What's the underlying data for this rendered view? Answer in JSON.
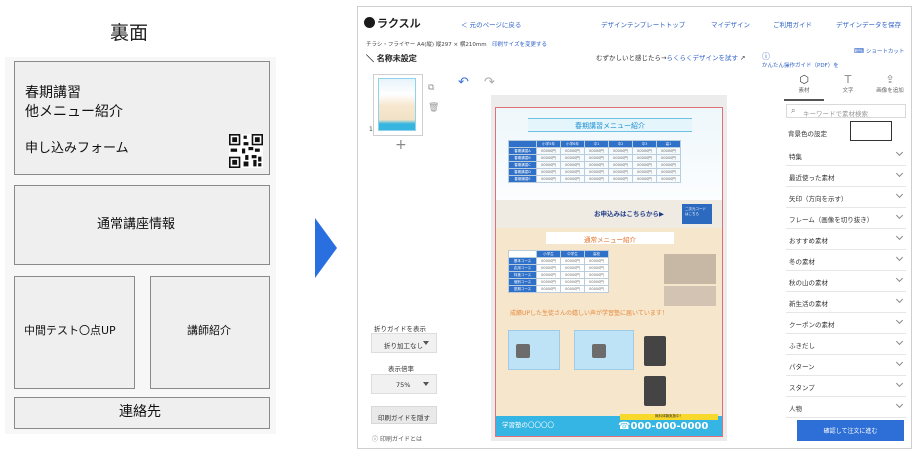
{
  "wireframe": {
    "title": "裏面",
    "box1": {
      "line1": "春期講習",
      "line2": "他メニュー紹介",
      "line3": "申し込みフォーム"
    },
    "box2": "通常講座情報",
    "box3": "中間テスト〇点UP",
    "box4": "講師紹介",
    "box5": "連絡先"
  },
  "app": {
    "logo": "ラクスル",
    "nav": [
      "＜ 元のページに戻る",
      "デザインテンプレートトップ",
      "マイデザイン",
      "ご利用ガイド",
      "デザインデータを保存"
    ],
    "product_line": "チラシ・フライヤー A4(縦)  縦297 × 横210mm",
    "change_size": "印刷サイズを変更する",
    "title": "名称未設定",
    "hint_prefix": "むずかしいと感じたら→",
    "hint_link": "らくらくデザインを試す",
    "help": "かんたん操作ガイド（PDF）を",
    "shortcut": "ショートカット"
  },
  "pages": {
    "num": "1",
    "add": "+"
  },
  "left_controls": {
    "guide_label": "折りガイドを表示",
    "guide_value": "折り加工なし",
    "zoom_label": "表示倍率",
    "zoom_value": "75%",
    "print_guide_btn": "印刷ガイドを隠す",
    "print_help": "印刷ガイドとは"
  },
  "flyer": {
    "h1": "春期講習メニュー紹介",
    "table1_headers": [
      "",
      "小学5年",
      "小学6年",
      "中1",
      "中2",
      "中3",
      "高1"
    ],
    "table1_rows": [
      "春期講習A",
      "春期講習B",
      "春期講習C",
      "春期講習D",
      "春期講習E"
    ],
    "cell": "00000円",
    "cta": "お申込みはこちらから▶",
    "cta_box": "二次元コードはこちら",
    "h2": "通常メニュー紹介",
    "table2_headers": [
      "",
      "小学生",
      "中学生",
      "高校"
    ],
    "table2_rows": [
      "基本コース",
      "応用コース",
      "特進コース",
      "個別コース",
      "夏期コース"
    ],
    "orange_text": "成績UPした生徒さんの嬉しい声が学習塾に届いています！",
    "school": "学習塾の〇〇〇〇",
    "tag": "無料体験実施中！",
    "tel": "☎000-000-0000"
  },
  "right_panel": {
    "tools": [
      "素材",
      "文字",
      "画像を追加"
    ],
    "search_placeholder": "キーワードで素材検索",
    "bg_label": "背景色の設定",
    "categories": [
      "特集",
      "最近使った素材",
      "矢印（方向を示す）",
      "フレーム（画像を切り抜き）",
      "おすすめ素材",
      "冬の素材",
      "秋の山の素材",
      "新生活の素材",
      "クーポンの素材",
      "ふきだし",
      "パターン",
      "スタンプ",
      "人物"
    ],
    "confirm_btn": "確認して注文に進む"
  },
  "colors": {
    "accent": "#2d6fd6",
    "flyer_blue": "#34b5e3",
    "arrow": "#2a6fe0"
  }
}
